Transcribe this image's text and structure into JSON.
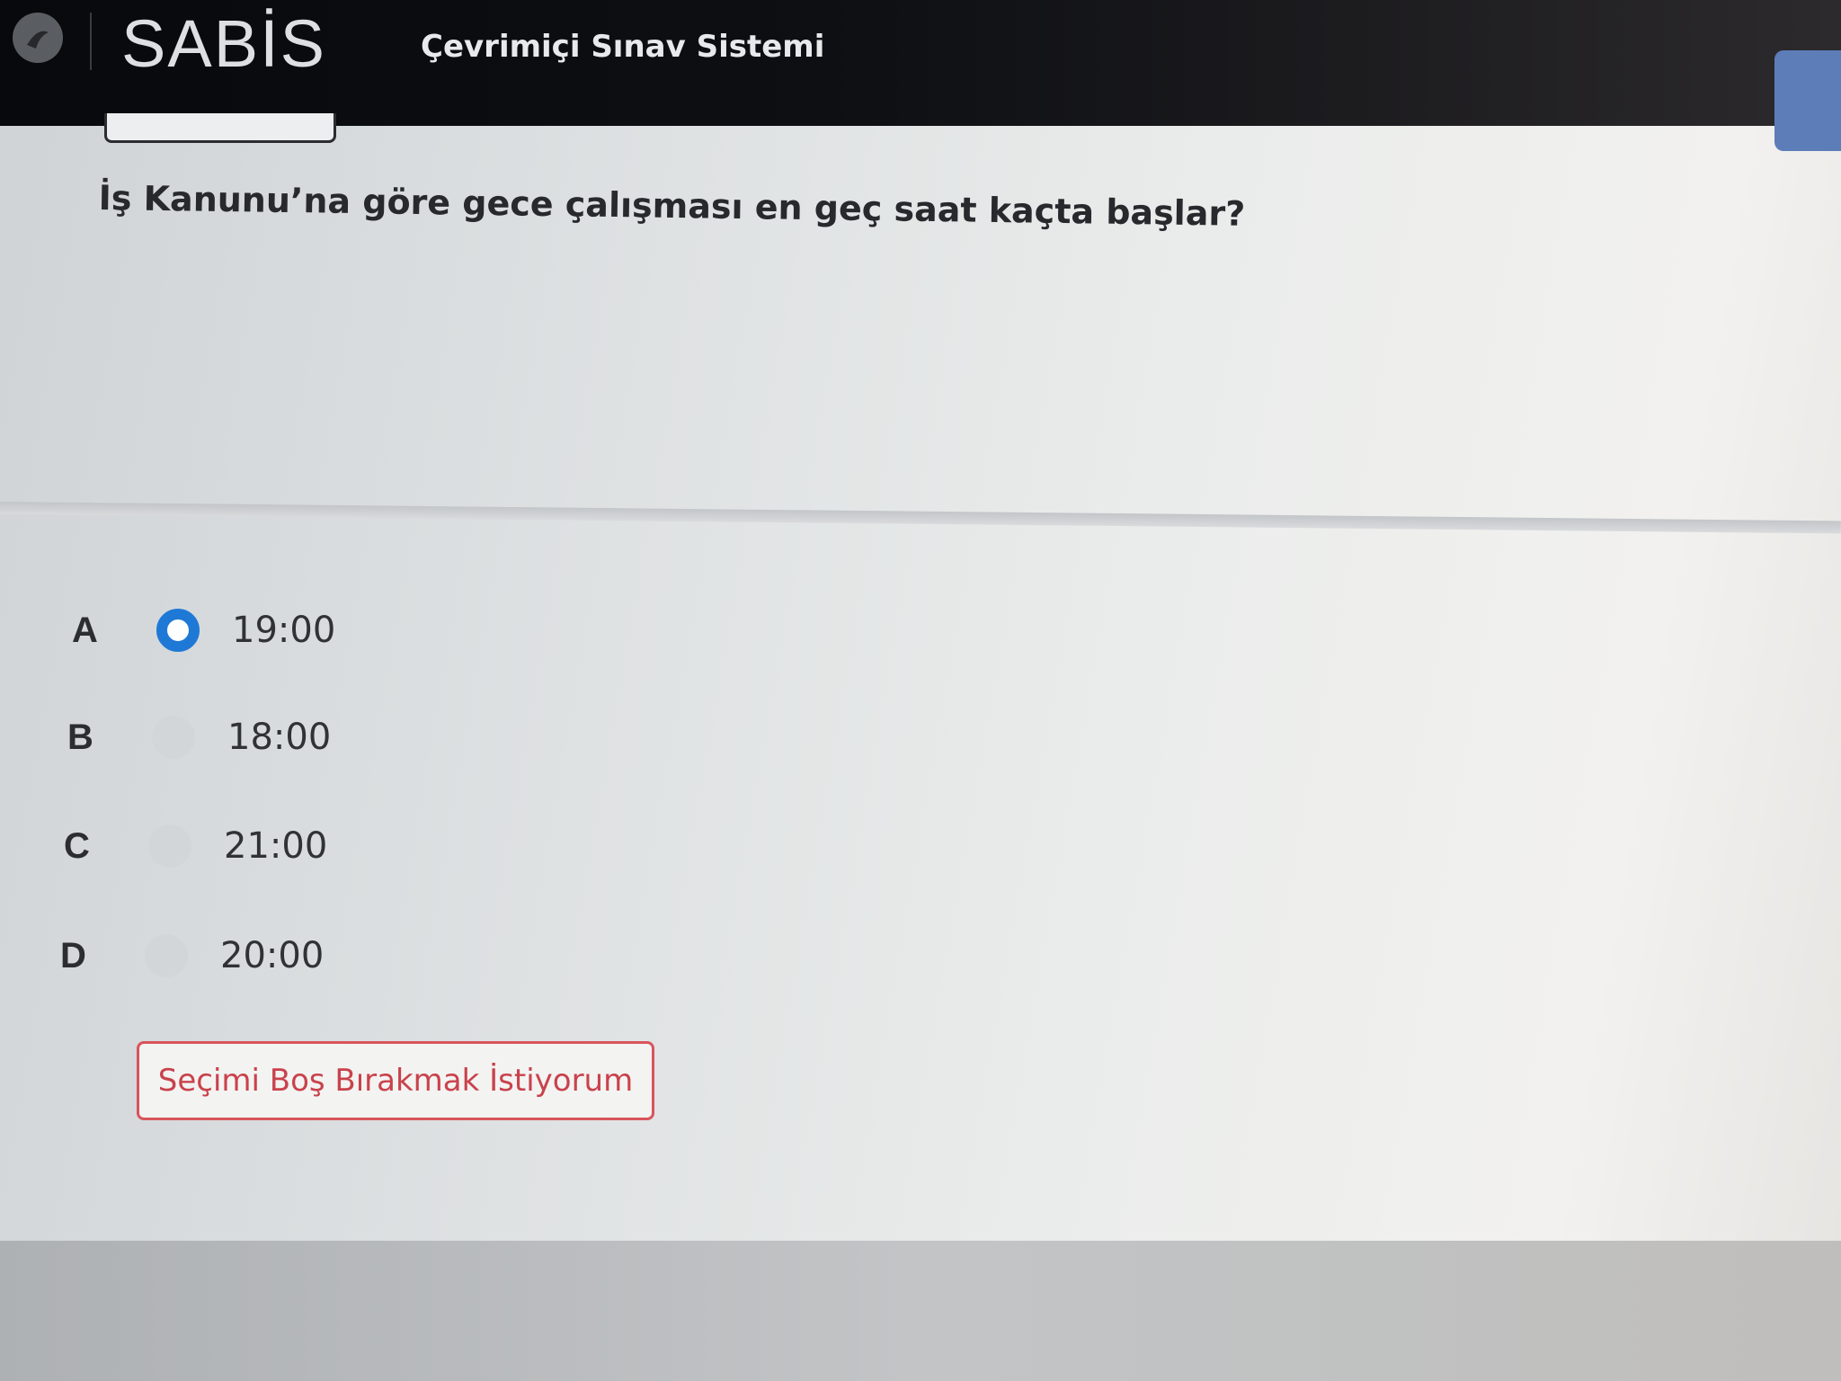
{
  "header": {
    "logo_text": "SABİS",
    "app_title": "Çevrimiçi Sınav Sistemi"
  },
  "question": {
    "text": "İş Kanunu’na göre gece çalışması en geç saat kaçta başlar?"
  },
  "options": [
    {
      "letter": "A",
      "label": "19:00",
      "selected": true
    },
    {
      "letter": "B",
      "label": "18:00",
      "selected": false
    },
    {
      "letter": "C",
      "label": "21:00",
      "selected": false
    },
    {
      "letter": "D",
      "label": "20:00",
      "selected": false
    }
  ],
  "actions": {
    "skip_label": "Seçimi Boş Bırakmak İstiyorum"
  },
  "colors": {
    "selected_radio": "#1e79d6",
    "skip_button": "#d9545c",
    "header_bg": "#0b0c10"
  }
}
